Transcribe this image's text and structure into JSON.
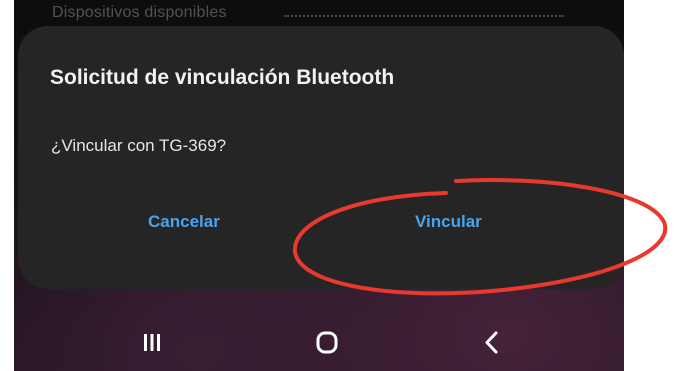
{
  "background": {
    "section_header": "Dispositivos disponibles"
  },
  "dialog": {
    "title": "Solicitud de vinculación Bluetooth",
    "message": "¿Vincular con TG-369?",
    "cancel_label": "Cancelar",
    "pair_label": "Vincular"
  },
  "navbar": {
    "recents_icon": "recent-apps-icon",
    "home_icon": "home-icon",
    "back_icon": "back-icon"
  },
  "colors": {
    "dialog_background": "#252525",
    "button_text": "#4aa3ec",
    "annotation": "#e8392e"
  }
}
